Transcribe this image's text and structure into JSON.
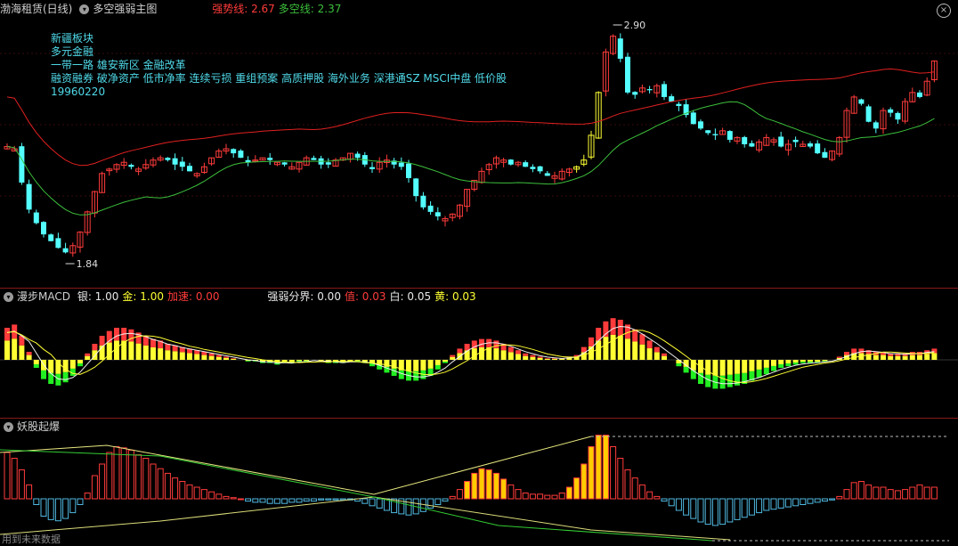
{
  "panel1": {
    "title": "渤海租赁(日线)",
    "indicator": "多空强弱主图",
    "strong_label": "强势线: 2.67",
    "bull_bear_label": "多空线: 2.37",
    "high_label": "2.90",
    "low_label": "1.84",
    "sectors": [
      "新疆板块",
      "多元金融",
      "一带一路 雄安新区 金融改革",
      "融资融券 破净资产 低市净率 连续亏损 重组预案 高质押股 海外业务 深港通SZ MSCI中盘 低价股",
      "19960220"
    ]
  },
  "panel2": {
    "title": "漫步MACD",
    "silver": "银: 1.00",
    "gold": "金: 1.00",
    "accel": "加速: 0.00",
    "boundary": "强弱分界: 0.00",
    "value": "值: 0.03",
    "white": "白: 0.05",
    "yellow": "黄: 0.03"
  },
  "panel3": {
    "title": "妖股起爆",
    "footer": "用到未来数据"
  },
  "colors": {
    "up": "#ff3b3b",
    "down": "#54ffff",
    "ma_red": "#e02020",
    "ma_green": "#3cbf3c",
    "yellow": "#ffff33",
    "macd_green": "#22ee22",
    "text_cyan": "#4fd9e8"
  },
  "chart_data": [
    {
      "type": "candlestick",
      "ylim": [
        1.84,
        2.9
      ],
      "max": 2.9,
      "min": 1.84,
      "strong_line": 2.67,
      "bull_bear_line": 2.37,
      "closes": [
        2.36,
        2.35,
        2.2,
        2.08,
        2.02,
        1.97,
        1.94,
        1.91,
        1.89,
        1.92,
        1.98,
        2.07,
        2.16,
        2.24,
        2.26,
        2.28,
        2.29,
        2.27,
        2.26,
        2.28,
        2.3,
        2.31,
        2.3,
        2.28,
        2.27,
        2.25,
        2.24,
        2.27,
        2.31,
        2.34,
        2.35,
        2.33,
        2.31,
        2.29,
        2.3,
        2.31,
        2.3,
        2.29,
        2.28,
        2.27,
        2.29,
        2.31,
        2.3,
        2.28,
        2.28,
        2.3,
        2.31,
        2.33,
        2.31,
        2.28,
        2.26,
        2.29,
        2.3,
        2.28,
        2.27,
        2.22,
        2.14,
        2.09,
        2.07,
        2.05,
        2.04,
        2.06,
        2.1,
        2.17,
        2.21,
        2.25,
        2.28,
        2.31,
        2.3,
        2.28,
        2.29,
        2.27,
        2.26,
        2.25,
        2.23,
        2.23,
        2.25,
        2.26,
        2.27,
        2.3,
        2.41,
        2.6,
        2.78,
        2.85,
        2.75,
        2.6,
        2.59,
        2.62,
        2.61,
        2.63,
        2.58,
        2.56,
        2.54,
        2.5,
        2.46,
        2.44,
        2.42,
        2.41,
        2.43,
        2.39,
        2.4,
        2.37,
        2.36,
        2.38,
        2.4,
        2.39,
        2.36,
        2.37,
        2.38,
        2.37,
        2.36,
        2.33,
        2.31,
        2.34,
        2.4,
        2.52,
        2.58,
        2.55,
        2.47,
        2.44,
        2.52,
        2.51,
        2.48,
        2.56,
        2.6,
        2.58,
        2.65,
        2.74
      ]
    },
    {
      "type": "bar",
      "title": "漫步MACD",
      "series": [
        {
          "name": "银",
          "values": [
            0.2,
            0.22,
            0.15,
            0.05,
            -0.05,
            -0.12,
            -0.15,
            -0.16,
            -0.14,
            -0.1,
            -0.04,
            0.04,
            0.1,
            0.15,
            0.18,
            0.2,
            0.2,
            0.19,
            0.17,
            0.15,
            0.13,
            0.12,
            0.1,
            0.09,
            0.08,
            0.07,
            0.06,
            0.05,
            0.04,
            0.03,
            0.02,
            0.01,
            0.0,
            -0.01,
            -0.01,
            -0.02,
            -0.02,
            -0.03,
            -0.02,
            -0.02,
            -0.01,
            -0.01,
            0.0,
            -0.01,
            -0.02,
            -0.02,
            -0.02,
            -0.01,
            -0.01,
            -0.02,
            -0.04,
            -0.06,
            -0.08,
            -0.1,
            -0.12,
            -0.13,
            -0.13,
            -0.12,
            -0.1,
            -0.06,
            -0.02,
            0.03,
            0.07,
            0.1,
            0.12,
            0.13,
            0.13,
            0.12,
            0.1,
            0.08,
            0.06,
            0.04,
            0.03,
            0.02,
            0.01,
            0.01,
            0.01,
            0.02,
            0.03,
            0.08,
            0.14,
            0.2,
            0.24,
            0.26,
            0.25,
            0.22,
            0.19,
            0.16,
            0.12,
            0.08,
            0.04,
            0.0,
            -0.04,
            -0.08,
            -0.12,
            -0.15,
            -0.17,
            -0.18,
            -0.18,
            -0.17,
            -0.16,
            -0.15,
            -0.13,
            -0.11,
            -0.09,
            -0.07,
            -0.05,
            -0.04,
            -0.03,
            -0.02,
            -0.02,
            -0.02,
            -0.01,
            0.0,
            0.02,
            0.05,
            0.07,
            0.07,
            0.06,
            0.05,
            0.05,
            0.04,
            0.04,
            0.04,
            0.05,
            0.05,
            0.06,
            0.07
          ]
        }
      ]
    },
    {
      "type": "bar",
      "title": "妖股起爆",
      "series": [
        {
          "name": "妖股起爆",
          "values": [
            0.4,
            0.35,
            0.25,
            0.12,
            -0.05,
            -0.15,
            -0.18,
            -0.19,
            -0.17,
            -0.12,
            -0.05,
            0.05,
            0.2,
            0.3,
            0.4,
            0.45,
            0.44,
            0.42,
            0.38,
            0.35,
            0.3,
            0.26,
            0.22,
            0.18,
            0.15,
            0.12,
            0.1,
            0.08,
            0.06,
            0.04,
            0.02,
            0.01,
            0.0,
            -0.02,
            -0.03,
            -0.03,
            -0.04,
            -0.04,
            -0.04,
            -0.03,
            -0.03,
            -0.02,
            -0.02,
            -0.01,
            -0.01,
            -0.01,
            -0.01,
            -0.01,
            -0.02,
            -0.04,
            -0.06,
            -0.08,
            -0.1,
            -0.12,
            -0.13,
            -0.14,
            -0.13,
            -0.11,
            -0.08,
            -0.05,
            -0.02,
            0.02,
            0.08,
            0.15,
            0.22,
            0.26,
            0.25,
            0.22,
            0.17,
            0.12,
            0.08,
            0.05,
            0.04,
            0.04,
            0.03,
            0.03,
            0.05,
            0.1,
            0.18,
            0.3,
            0.45,
            0.55,
            0.55,
            0.45,
            0.35,
            0.25,
            0.18,
            0.12,
            0.06,
            0.02,
            -0.02,
            -0.06,
            -0.1,
            -0.14,
            -0.17,
            -0.2,
            -0.22,
            -0.23,
            -0.22,
            -0.2,
            -0.18,
            -0.16,
            -0.14,
            -0.12,
            -0.1,
            -0.09,
            -0.08,
            -0.07,
            -0.06,
            -0.05,
            -0.04,
            -0.03,
            -0.02,
            -0.01,
            0.02,
            0.08,
            0.14,
            0.15,
            0.12,
            0.1,
            0.1,
            0.08,
            0.07,
            0.08,
            0.1,
            0.12,
            0.1,
            0.1
          ]
        }
      ]
    }
  ]
}
